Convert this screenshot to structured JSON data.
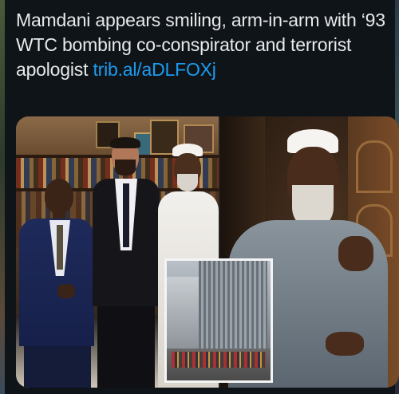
{
  "tweet": {
    "text": "Mamdani appears smiling, arm-in-arm with ‘93 WTC bombing co-conspirator and terrorist apologist ",
    "link_text": "trib.al/aDLFOXj"
  },
  "colors": {
    "background": "#0f1419",
    "text": "#e7e9ea",
    "link": "#1d9bf0"
  }
}
